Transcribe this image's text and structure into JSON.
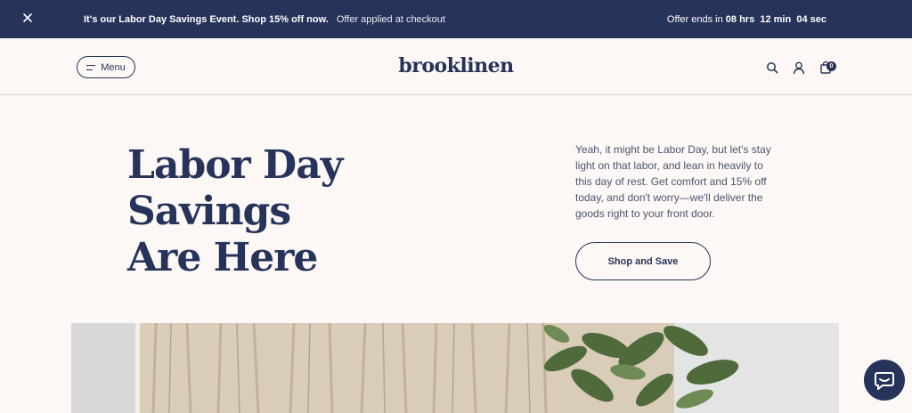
{
  "promo": {
    "headline": "It's our Labor Day Savings Event. Shop 15% off now.",
    "subtext": "Offer applied at checkout",
    "timer_prefix": "Offer ends in",
    "hours": "08",
    "hours_label": "hrs",
    "minutes": "12",
    "minutes_label": "min",
    "seconds": "04",
    "seconds_label": "sec"
  },
  "header": {
    "menu_label": "Menu",
    "logo": "brooklinen",
    "cart_count": "0"
  },
  "hero": {
    "title_line1": "Labor Day Savings",
    "title_line2": "Are Here",
    "body": "Yeah, it might be Labor Day, but let's stay light on that labor, and lean in heavily to this day of rest. Get comfort and 15% off today, and don't worry—we'll deliver the goods right to your front door.",
    "cta": "Shop and Save"
  },
  "colors": {
    "navy": "#26335a",
    "background": "#fdf8f5"
  }
}
